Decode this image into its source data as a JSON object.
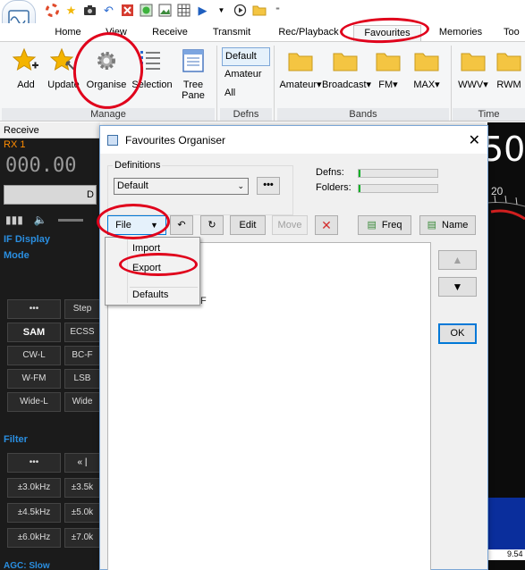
{
  "quick_access": {
    "icons": [
      "lifebuoy-icon",
      "favourite-star-icon",
      "camera-icon",
      "undo-icon",
      "close-red-icon",
      "record-green-icon",
      "image-icon",
      "grid-icon",
      "play-icon",
      "dropdown-arrow-icon",
      "play-circle-icon",
      "folder-icon",
      "customize-icon"
    ]
  },
  "tabs": {
    "home": "Home",
    "view": "View",
    "receive": "Receive",
    "transmit": "Transmit",
    "rec_playback": "Rec/Playback",
    "favourites": "Favourites",
    "memories": "Memories",
    "tools": "Too"
  },
  "ribbon": {
    "add": "Add",
    "update": "Update",
    "organise": "Organise",
    "selection": "Selection",
    "tree": "Tree",
    "pane": "Pane",
    "manage_group": "Manage",
    "defns": {
      "default": "Default",
      "amateur": "Amateur",
      "all": "All",
      "group": "Defns"
    },
    "bands": {
      "amateur": "Amateur",
      "broadcast": "Broadcast",
      "fm": "FM",
      "max": "MAX",
      "group": "Bands"
    },
    "time": {
      "wwv": "WWV",
      "rwm": "RWM",
      "group": "Time"
    }
  },
  "left_panel": {
    "header": "Receive",
    "rx": "RX 1",
    "frequency": "000.00",
    "bar_text": "D",
    "if_display": "IF Display",
    "mode": "Mode",
    "mode_buttons": [
      "•••",
      "Step",
      "SAM",
      "ECSS",
      "CW-L",
      "BC-F",
      "W-FM",
      "LSB",
      "Wide-L",
      "Wide"
    ],
    "filter": "Filter",
    "filter_buttons": [
      "•••",
      "« |",
      "±3.0kHz",
      "±3.5k",
      "±4.5kHz",
      "±5.0k",
      "±6.0kHz",
      "±7.0k"
    ],
    "agc": "AGC: Slow"
  },
  "right_panel": {
    "freq_fragment": "50",
    "scale_fragment": "20",
    "bottom_value": "9.54"
  },
  "dialog": {
    "title": "Favourites Organiser",
    "definitions_label": "Definitions",
    "definitions_value": "Default",
    "defns_label": "Defns:",
    "folders_label": "Folders:",
    "file_btn": "File",
    "edit_btn": "Edit",
    "move_btn": "Move",
    "freq_btn": "Freq",
    "name_btn": "Name",
    "ok_btn": "OK",
    "list_fragment": "F"
  },
  "file_menu": {
    "import": "Import",
    "export": "Export",
    "defaults": "Defaults"
  },
  "colors": {
    "annotation": "#e0001b",
    "accent": "#2a8ee0",
    "rx_orange": "#ff8c00",
    "progress_green": "#06b025"
  }
}
